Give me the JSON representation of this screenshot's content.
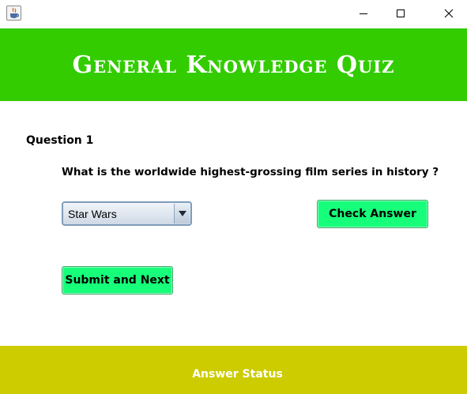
{
  "window": {
    "icon": "java-cup-icon",
    "controls": [
      "minimize-icon",
      "maximize-icon",
      "close-icon"
    ]
  },
  "header": {
    "title": "General Knowledge Quiz",
    "background": "#33cc00"
  },
  "question": {
    "number_label": "Question 1",
    "text": "What is the worldwide highest-grossing film series in history ?"
  },
  "answer_select": {
    "selected": "Star Wars"
  },
  "buttons": {
    "check_label": "Check Answer",
    "submit_label": "Submit and Next",
    "color": "#17ff7a"
  },
  "footer": {
    "status_label": "Answer Status",
    "background": "#cccc00"
  }
}
